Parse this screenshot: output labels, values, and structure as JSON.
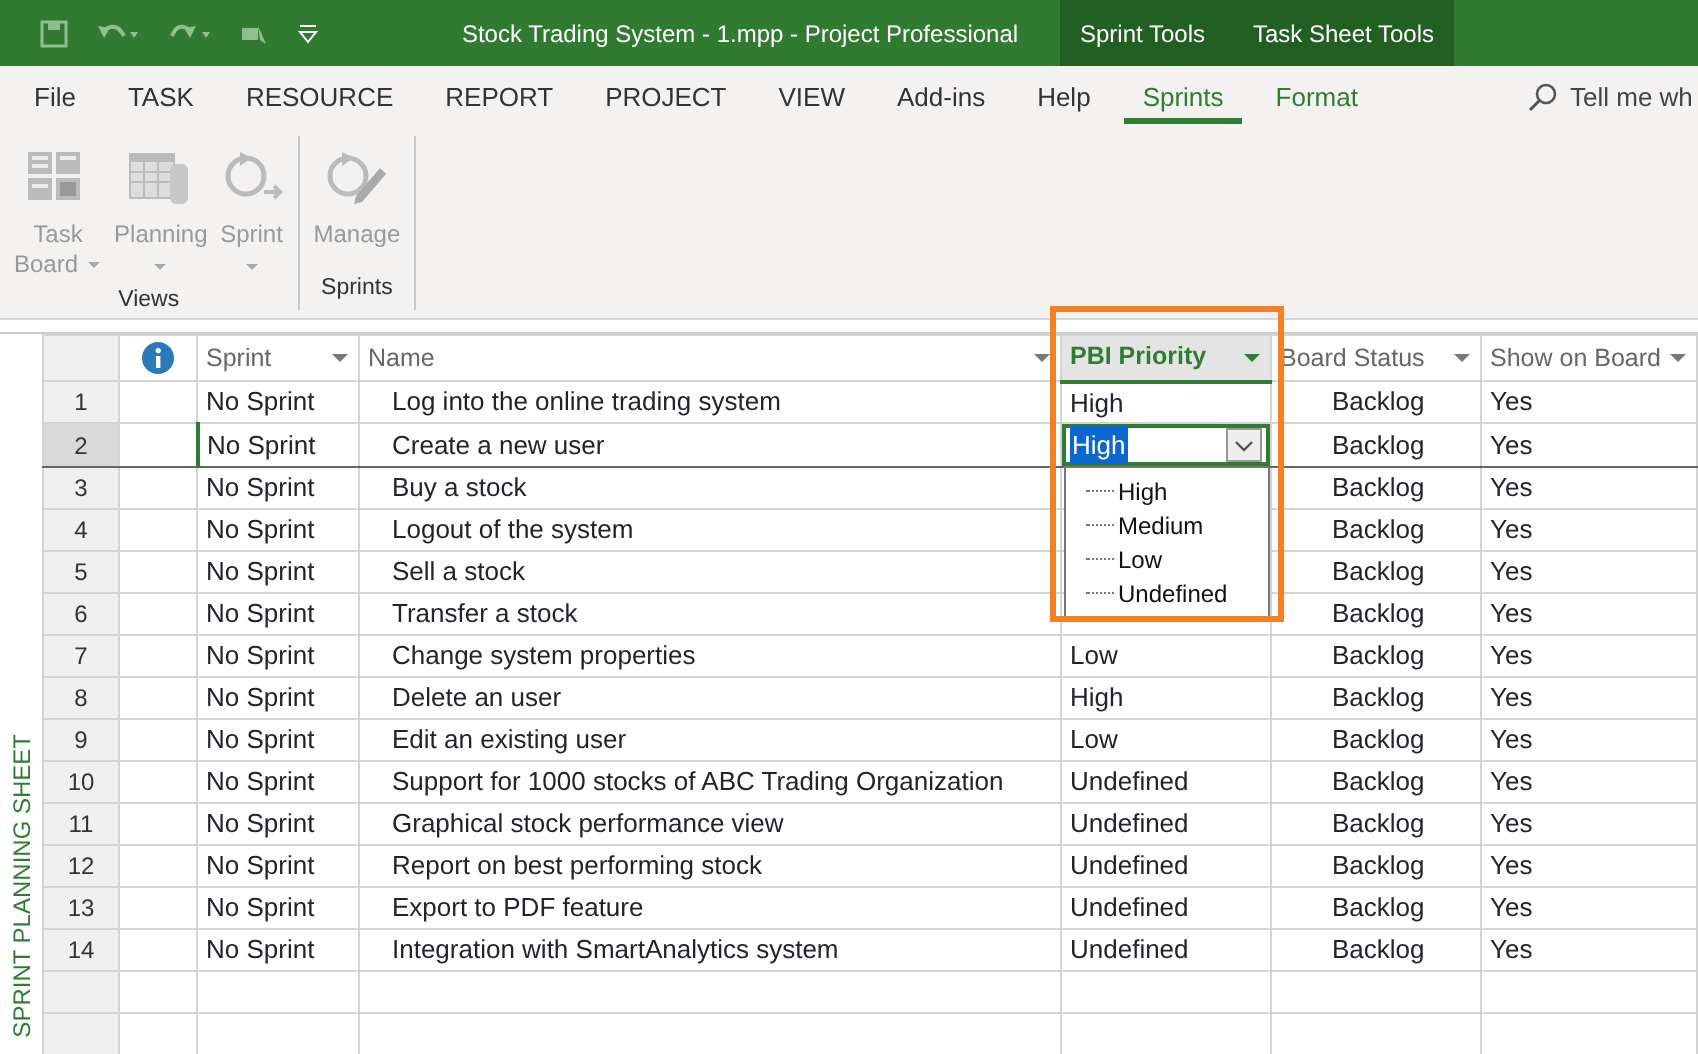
{
  "window": {
    "title": "Stock Trading System - 1.mpp  -  Project Professional",
    "context_tabs": [
      {
        "label": "Sprint Tools"
      },
      {
        "label": "Task Sheet Tools"
      }
    ]
  },
  "ribbon_tabs": [
    {
      "label": "File",
      "selected": false,
      "kind": "normal"
    },
    {
      "label": "TASK",
      "selected": false,
      "kind": "normal"
    },
    {
      "label": "RESOURCE",
      "selected": false,
      "kind": "normal"
    },
    {
      "label": "REPORT",
      "selected": false,
      "kind": "normal"
    },
    {
      "label": "PROJECT",
      "selected": false,
      "kind": "normal"
    },
    {
      "label": "VIEW",
      "selected": false,
      "kind": "normal"
    },
    {
      "label": "Add-ins",
      "selected": false,
      "kind": "normal"
    },
    {
      "label": "Help",
      "selected": false,
      "kind": "normal"
    },
    {
      "label": "Sprints",
      "selected": true,
      "kind": "context"
    },
    {
      "label": "Format",
      "selected": false,
      "kind": "context"
    }
  ],
  "tell_me": {
    "placeholder": "Tell me wh"
  },
  "ribbon_groups": [
    {
      "label": "Views",
      "buttons": [
        {
          "label": "Task Board",
          "has_menu": true,
          "disabled": true
        },
        {
          "label": "Planning",
          "has_menu": true,
          "disabled": true
        },
        {
          "label": "Sprint",
          "has_menu": true,
          "disabled": true
        }
      ]
    },
    {
      "label": "Sprints",
      "buttons": [
        {
          "label": "Manage",
          "has_menu": false,
          "disabled": true
        }
      ]
    }
  ],
  "sheet": {
    "side_label": "SPRINT PLANNING SHEET",
    "columns": [
      {
        "kind": "indicator"
      },
      {
        "label": "Sprint",
        "kind": "text",
        "selected": false
      },
      {
        "label": "Name",
        "kind": "text",
        "selected": false
      },
      {
        "label": "PBI Priority",
        "kind": "text",
        "selected": true
      },
      {
        "label": "Board Status",
        "kind": "text",
        "selected": false
      },
      {
        "label": "Show on Board",
        "kind": "text",
        "selected": false
      }
    ],
    "rows": [
      {
        "id": "1",
        "sprint": "No Sprint",
        "name": "Log into the online trading system",
        "priority": "High",
        "board_status": "Backlog",
        "show_on_board": "Yes",
        "selected": false,
        "editing": false
      },
      {
        "id": "2",
        "sprint": "No Sprint",
        "name": "Create a new user",
        "priority": "High",
        "board_status": "Backlog",
        "show_on_board": "Yes",
        "selected": true,
        "editing": true
      },
      {
        "id": "3",
        "sprint": "No Sprint",
        "name": "Buy a stock",
        "board_status": "Backlog",
        "show_on_board": "Yes",
        "selected": false,
        "editing": false
      },
      {
        "id": "4",
        "sprint": "No Sprint",
        "name": "Logout of the system",
        "board_status": "Backlog",
        "show_on_board": "Yes",
        "selected": false,
        "editing": false
      },
      {
        "id": "5",
        "sprint": "No Sprint",
        "name": "Sell a stock",
        "board_status": "Backlog",
        "show_on_board": "Yes",
        "selected": false,
        "editing": false
      },
      {
        "id": "6",
        "sprint": "No Sprint",
        "name": "Transfer a stock",
        "board_status": "Backlog",
        "show_on_board": "Yes",
        "selected": false,
        "editing": false
      },
      {
        "id": "7",
        "sprint": "No Sprint",
        "name": "Change system properties",
        "priority": "Low",
        "board_status": "Backlog",
        "show_on_board": "Yes",
        "selected": false,
        "editing": false
      },
      {
        "id": "8",
        "sprint": "No Sprint",
        "name": "Delete an user",
        "priority": "High",
        "board_status": "Backlog",
        "show_on_board": "Yes",
        "selected": false,
        "editing": false
      },
      {
        "id": "9",
        "sprint": "No Sprint",
        "name": "Edit an existing user",
        "priority": "Low",
        "board_status": "Backlog",
        "show_on_board": "Yes",
        "selected": false,
        "editing": false
      },
      {
        "id": "10",
        "sprint": "No Sprint",
        "name": "Support for 1000 stocks of ABC Trading Organization",
        "priority": "Undefined",
        "board_status": "Backlog",
        "show_on_board": "Yes",
        "selected": false,
        "editing": false
      },
      {
        "id": "11",
        "sprint": "No Sprint",
        "name": "Graphical stock performance view",
        "priority": "Undefined",
        "board_status": "Backlog",
        "show_on_board": "Yes",
        "selected": false,
        "editing": false
      },
      {
        "id": "12",
        "sprint": "No Sprint",
        "name": "Report on best performing stock",
        "priority": "Undefined",
        "board_status": "Backlog",
        "show_on_board": "Yes",
        "selected": false,
        "editing": false
      },
      {
        "id": "13",
        "sprint": "No Sprint",
        "name": "Export to PDF feature",
        "priority": "Undefined",
        "board_status": "Backlog",
        "show_on_board": "Yes",
        "selected": false,
        "editing": false
      },
      {
        "id": "14",
        "sprint": "No Sprint",
        "name": "Integration with SmartAnalytics system",
        "priority": "Undefined",
        "board_status": "Backlog",
        "show_on_board": "Yes",
        "selected": false,
        "editing": false
      }
    ],
    "priority_options": [
      "High",
      "Medium",
      "Low",
      "Undefined"
    ]
  }
}
